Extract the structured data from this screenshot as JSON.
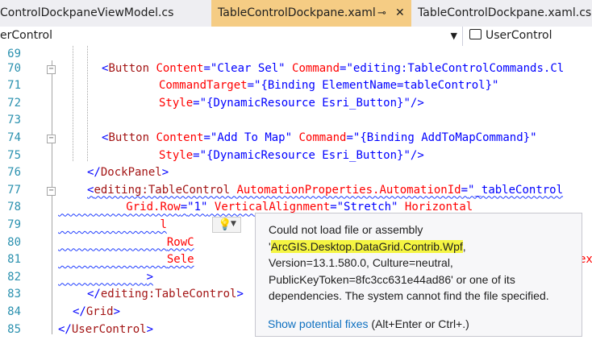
{
  "tabs": [
    {
      "label": "ControlDockpaneViewModel.cs",
      "active": false
    },
    {
      "label": "TableControlDockpane.xaml",
      "active": true
    },
    {
      "label": "TableControlDockpane.xaml.cs",
      "active": false
    }
  ],
  "tab_icons": {
    "pin": "⊸",
    "close": "✕"
  },
  "nav": {
    "left": "erControl",
    "right": "UserControl"
  },
  "colors": {
    "active_tab": "#f5cc84",
    "line_number": "#2b91af",
    "squiggle": "#1e3cff",
    "highlight": "#f5f542",
    "link": "#0e70c0"
  },
  "lines": [
    {
      "n": "69"
    },
    {
      "n": "70",
      "p1": "<",
      "tag": "Button",
      "a1": " Content",
      "eq1": "=",
      "v1": "\"Clear Sel\"",
      "a2": " Command",
      "eq2": "=",
      "v2": "\"editing:TableControlCommands.Cl"
    },
    {
      "n": "71",
      "a1": "CommandTarget",
      "eq1": "=",
      "v1": "\"{Binding ElementName=tableControl}\""
    },
    {
      "n": "72",
      "a1": "Style",
      "eq1": "=",
      "v1": "\"{DynamicResource Esri_Button}\"",
      "p2": "/>"
    },
    {
      "n": "73"
    },
    {
      "n": "74",
      "p1": "<",
      "tag": "Button",
      "a1": " Content",
      "eq1": "=",
      "v1": "\"Add To Map\"",
      "a2": " Command",
      "eq2": "=",
      "v2": "\"{Binding AddToMapCommand}\""
    },
    {
      "n": "75",
      "a1": "Style",
      "eq1": "=",
      "v1": "\"{DynamicResource Esri_Button}\"",
      "p2": "/>"
    },
    {
      "n": "76",
      "p1": "</",
      "tag": "DockPanel",
      "p2": ">"
    },
    {
      "n": "77",
      "p1": "<",
      "tag": "editing:TableControl",
      "a1": " AutomationProperties.AutomationId",
      "eq1": "=",
      "v1": "\"_tableControl"
    },
    {
      "n": "78",
      "a1": "Grid.Row",
      "eq1": "=",
      "v1": "\"1\"",
      "a2": " VerticalAlignment",
      "eq2": "=",
      "v2": "\"Stretch\"",
      "a3": " Horizontal"
    },
    {
      "n": "79",
      "a1": "l"
    },
    {
      "n": "80",
      "a1": "RowC"
    },
    {
      "n": "81",
      "a1": "Sele",
      "right": "ex"
    },
    {
      "n": "82",
      "p1": ">"
    },
    {
      "n": "83",
      "p1": "</",
      "tag": "editing:TableControl",
      "p2": ">"
    },
    {
      "n": "84",
      "p1": "</",
      "tag": "Grid",
      "p2": ">"
    },
    {
      "n": "85",
      "p1": "</",
      "tag": "UserControl",
      "p2": ">"
    }
  ],
  "tooltip": {
    "line1": "Could not load file or assembly",
    "quote": "'",
    "assembly": "ArcGIS.Desktop.DataGrid.Contrib.Wpf",
    "comma": ",",
    "line3": "Version=13.1.580.0, Culture=neutral,",
    "line4": "PublicKeyToken=8fc3cc631e44ad86' or one of its",
    "line5": "dependencies. The system cannot find the file specified.",
    "fix_link": "Show potential fixes",
    "fix_shortcut": " (Alt+Enter or Ctrl+.)"
  }
}
